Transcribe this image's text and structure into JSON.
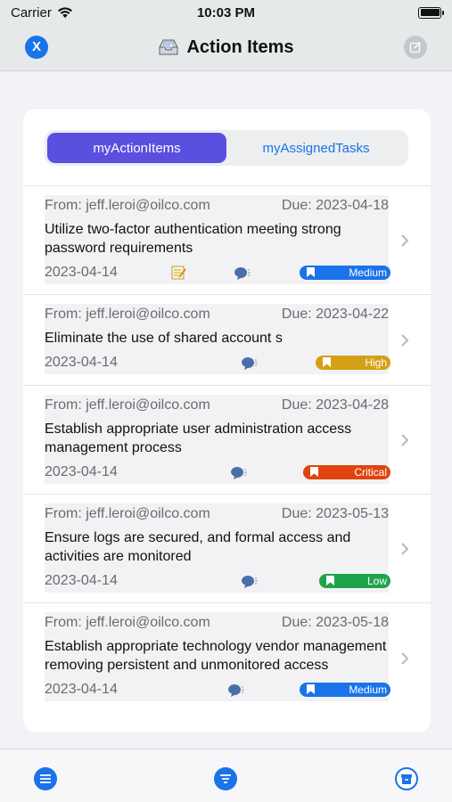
{
  "status_bar": {
    "carrier": "Carrier",
    "time": "10:03 PM"
  },
  "nav": {
    "close_label": "X",
    "title": "Action Items"
  },
  "tabs": [
    {
      "label": "myActionItems",
      "active": true
    },
    {
      "label": "myAssignedTasks",
      "active": false
    }
  ],
  "items": [
    {
      "from": "From: jeff.leroi@oilco.com",
      "due": "Due: 2023-04-18",
      "title": "Utilize two-factor authentication meeting strong password requirements",
      "date": "2023-04-14",
      "priority": "Medium",
      "priority_color": "#1a73e8",
      "has_note_icon": true
    },
    {
      "from": "From: jeff.leroi@oilco.com",
      "due": "Due: 2023-04-22",
      "title": "Eliminate the use of shared account s",
      "date": "2023-04-14",
      "priority": "High",
      "priority_color": "#d4a017",
      "has_note_icon": false
    },
    {
      "from": "From: jeff.leroi@oilco.com",
      "due": "Due: 2023-04-28",
      "title": "Establish appropriate user administration access management process",
      "date": "2023-04-14",
      "priority": "Critical",
      "priority_color": "#e0440e",
      "has_note_icon": false
    },
    {
      "from": "From: jeff.leroi@oilco.com",
      "due": "Due: 2023-05-13",
      "title": "Ensure logs are secured, and formal access and activities are monitored",
      "date": "2023-04-14",
      "priority": "Low",
      "priority_color": "#1fa34a",
      "has_note_icon": false
    },
    {
      "from": "From: jeff.leroi@oilco.com",
      "due": "Due: 2023-05-18",
      "title": "Establish appropriate technology vendor management removing persistent and unmonitored access",
      "date": "2023-04-14",
      "priority": "Medium",
      "priority_color": "#1a73e8",
      "has_note_icon": false
    }
  ],
  "tab_bar": {
    "icons": [
      "list-icon",
      "list-icon",
      "archive-icon"
    ]
  }
}
